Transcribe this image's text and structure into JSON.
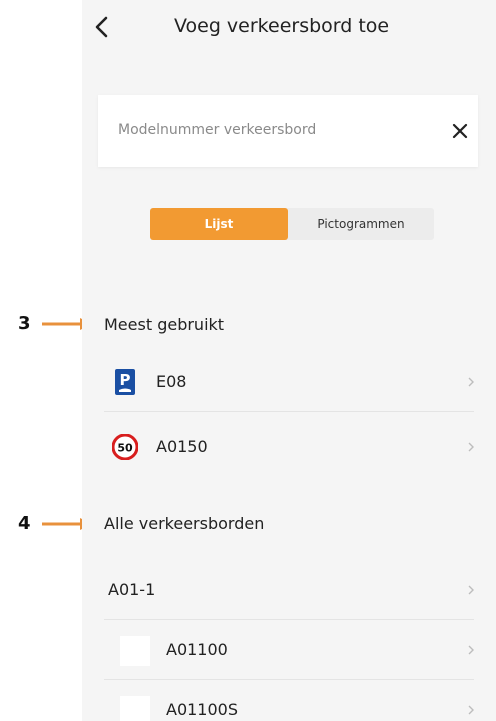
{
  "header": {
    "title": "Voeg verkeersbord toe",
    "back_icon": "chevron-left-icon"
  },
  "search": {
    "placeholder": "Modelnummer verkeersbord",
    "value": "",
    "clear_icon": "close-icon"
  },
  "view_toggle": {
    "options": [
      "Lijst",
      "Pictogrammen"
    ],
    "selected": "Lijst",
    "accent_color": "#f29a32"
  },
  "annotations": [
    {
      "label": "3",
      "color": "#e8913c"
    },
    {
      "label": "4",
      "color": "#e8913c"
    }
  ],
  "most_used": {
    "heading": "Meest gebruikt",
    "items": [
      {
        "label": "E08",
        "icon": "parking-sign-icon"
      },
      {
        "label": "A0150",
        "icon": "speed-limit-50-sign-icon",
        "icon_text": "50"
      }
    ]
  },
  "all_signs": {
    "heading": "Alle verkeersborden",
    "category": {
      "label": "A01-1"
    },
    "items": [
      {
        "label": "A01100",
        "icon": "blank-sign-icon"
      },
      {
        "label": "A01100S",
        "icon": "blank-sign-icon"
      }
    ]
  }
}
